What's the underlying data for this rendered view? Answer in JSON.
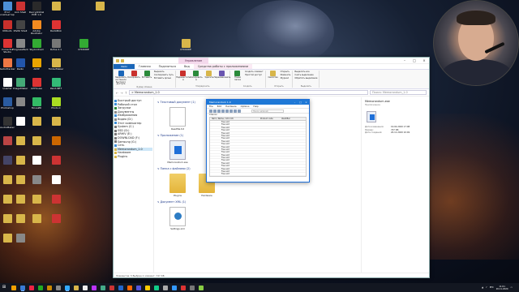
{
  "desktop": {
    "icons": [
      {
        "label": "Этот компьютер",
        "color": "#4c8fd6"
      },
      {
        "label": "Link Shell",
        "color": "#c33"
      },
      {
        "label": "DecryptIntel PCB 1.0",
        "color": "#2a2a2a"
      },
      {
        "label": "",
        "color": "#d8b64a"
      },
      {
        "label": "KMAuto",
        "color": "#c9302c"
      },
      {
        "label": "RiVAll Shell",
        "color": "#444"
      },
      {
        "label": "Adobe Illustrator",
        "color": "#f28b20"
      },
      {
        "label": "RadioBok",
        "color": "#d33"
      },
      {
        "label": "Corrector Studio",
        "color": "#d33"
      },
      {
        "label": "ProgressPack",
        "color": "#888"
      },
      {
        "label": "SkyAndraid",
        "color": "#3a3"
      },
      {
        "label": "Rufus 2.1",
        "color": "#777"
      },
      {
        "label": "RadioTracker",
        "color": "#e74"
      },
      {
        "label": "Radio",
        "color": "#2255aa"
      },
      {
        "label": "AIMP",
        "color": "#e8a400"
      },
      {
        "label": "FolderMaker",
        "color": "#d8b64a"
      },
      {
        "label": "Quarter",
        "color": "#fff"
      },
      {
        "label": "ImageMaker",
        "color": "#4a7"
      },
      {
        "label": "ArtHouse",
        "color": "#d33"
      },
      {
        "label": "Paint.NET",
        "color": "#3b7"
      },
      {
        "label": "Photoshop",
        "color": "#2a5ba0"
      },
      {
        "label": "",
        "color": "#888"
      },
      {
        "label": "МозаИК",
        "color": "#3b6"
      },
      {
        "label": "Photo.C",
        "color": "#ad2"
      },
      {
        "label": "AudioMaker",
        "color": "#333"
      },
      {
        "label": "",
        "color": "#fff"
      },
      {
        "label": "",
        "color": "#d8b64a"
      },
      {
        "label": "",
        "color": "#d8b64a"
      },
      {
        "label": "",
        "color": "#b44"
      },
      {
        "label": "",
        "color": "#d8b64a"
      },
      {
        "label": "",
        "color": "#d8b64a"
      },
      {
        "label": "",
        "color": "#c60"
      },
      {
        "label": "",
        "color": "#446"
      },
      {
        "label": "",
        "color": "#d8b64a"
      },
      {
        "label": "",
        "color": "#fff"
      },
      {
        "label": "",
        "color": "#c33"
      },
      {
        "label": "",
        "color": "#d8b64a"
      },
      {
        "label": "",
        "color": "#d8b64a"
      },
      {
        "label": "",
        "color": "#888"
      },
      {
        "label": "",
        "color": "#fff"
      },
      {
        "label": "",
        "color": "#d8b64a"
      },
      {
        "label": "",
        "color": "#d8b64a"
      },
      {
        "label": "",
        "color": "#d8b64a"
      },
      {
        "label": "",
        "color": "#c33"
      },
      {
        "label": "",
        "color": "#d8b64a"
      },
      {
        "label": "",
        "color": "#d8b64a"
      },
      {
        "label": "",
        "color": "#d8b64a"
      },
      {
        "label": "",
        "color": "#c33"
      },
      {
        "label": "",
        "color": "#d8b64a"
      },
      {
        "label": "",
        "color": "#888"
      },
      {
        "label": "CHOKIDE",
        "color": "#3a3"
      },
      {
        "label": "CHOKIDE",
        "color": "#d8b64a"
      },
      {
        "label": "",
        "color": "#d8b64a"
      }
    ]
  },
  "explorer": {
    "context_tab": "Управление",
    "tabs": [
      "Файл",
      "Главная",
      "Поделиться",
      "Вид",
      "Средства работы с приложениями"
    ],
    "ribbon": {
      "groups": [
        {
          "name": "Буфер обмена",
          "buttons": [
            "Закрепить на панели быстрого доступа",
            "Копировать",
            "Вставить"
          ],
          "small": [
            "Вырезать",
            "Скопировать путь",
            "Вставить ярлык"
          ]
        },
        {
          "name": "Упорядочить",
          "buttons": [
            "Переместить в",
            "Копировать в",
            "Удалить",
            "Переименовать"
          ],
          "small": []
        },
        {
          "name": "Создать",
          "buttons": [
            "Новая папка"
          ],
          "small": [
            "Создать элемент",
            "Простой доступ"
          ]
        },
        {
          "name": "Открыть",
          "buttons": [
            "Свойства"
          ],
          "small": [
            "Открыть",
            "Изменить",
            "Журнал"
          ]
        },
        {
          "name": "Выделить",
          "buttons": [],
          "small": [
            "Выделить все",
            "Снять выделение",
            "Обратить выделение"
          ]
        }
      ]
    },
    "address": {
      "path": "> Memorandum_1.0",
      "search_placeholder": "Поиск: Memorandum_1.0"
    },
    "nav_items": [
      "Быстрый доступ",
      "Рабочий стол",
      "Загрузки",
      "Документы",
      "Изображения",
      "Видео (D:)",
      "Этот компьютер",
      "System (C:)",
      "SSD (D:)",
      "ARHIV (E:)",
      "DOWNLOAD (F:)",
      "Samsung (G:)",
      "Сеть",
      "Memorandum_1.0",
      "Hardware",
      "Plugins"
    ],
    "selected_nav": 13,
    "groups": [
      {
        "header": "Текстовый документ (1)",
        "files": [
          {
            "name": "ReadMe.txt",
            "kind": "doc"
          }
        ]
      },
      {
        "header": "Приложение (1)",
        "files": [
          {
            "name": "Memorandum.exe",
            "kind": "exe"
          }
        ]
      },
      {
        "header": "Папка с файлами (2)",
        "files": [
          {
            "name": "Plugins",
            "kind": "folder"
          },
          {
            "name": "Hardware",
            "kind": "folder"
          }
        ]
      },
      {
        "header": "Документ XML (1)",
        "files": [
          {
            "name": "Settings.xml",
            "kind": "xml"
          }
        ]
      }
    ],
    "details": {
      "name": "Memorandum.exe",
      "type": "Приложение",
      "rows": [
        {
          "key": "Дата изменения:",
          "value": "19.02.2020 17:08"
        },
        {
          "key": "Размер:",
          "value": "747 КБ"
        },
        {
          "key": "Дата создания:",
          "value": "20.11.2020 10:49"
        }
      ]
    },
    "status": "Элементов: 5   Выбран 1 элемент: 747 КБ"
  },
  "memo": {
    "title": "Memorandum 1.0",
    "menu": [
      "File",
      "Edit",
      "Hardware",
      "Options",
      "Help"
    ],
    "search_placeholder": "Поиск записей",
    "label": "Список",
    "columns": [
      "Item / Name / info Info",
      "Product code",
      "Identifier"
    ],
    "rows": [
      "Free slot",
      "Free slot",
      "Free slot",
      "Free slot",
      "Free slot",
      "Free slot",
      "Free slot",
      "Free slot",
      "Free slot",
      "Free slot",
      "Free slot",
      "Free slot",
      "Free slot",
      "Free slot",
      "Free slot",
      "Free slot",
      "Free slot",
      "Free slot",
      "Free slot",
      "Free slot"
    ]
  },
  "taskbar": {
    "start_glyph": "⊞",
    "apps": [
      "#f0a000",
      "#3a7bd5",
      "#e24",
      "#2a2",
      "#c80",
      "#888",
      "#3af",
      "#d8b64a",
      "#eee",
      "#b3f",
      "#4a8",
      "#c33",
      "#26c",
      "#f60",
      "#55d",
      "#fc0",
      "#1c8",
      "#aaa",
      "#39f",
      "#d33",
      "#777",
      "#8c4"
    ],
    "language": "РУС",
    "time": "11:01",
    "date": "20.11.2020"
  }
}
